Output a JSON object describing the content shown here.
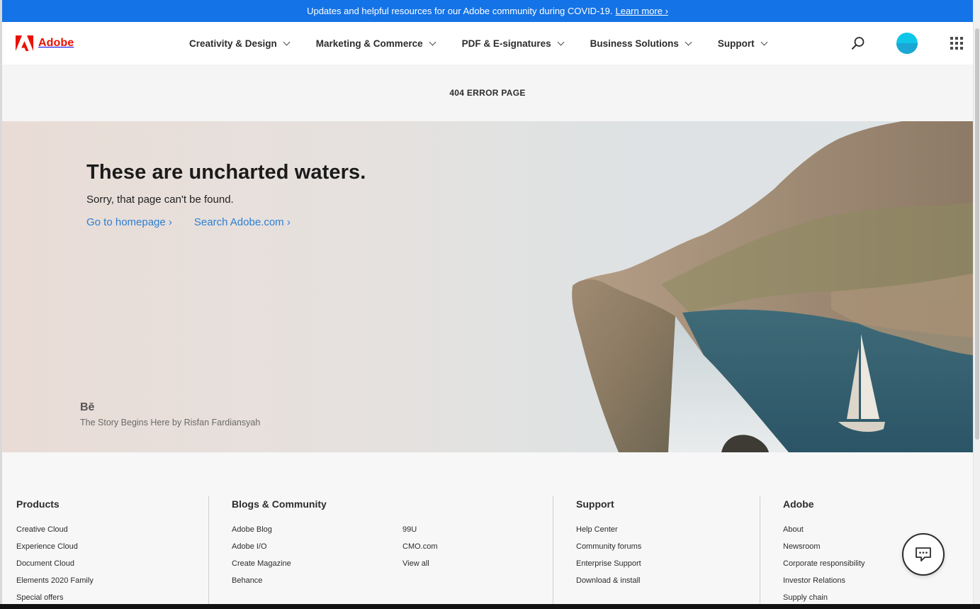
{
  "banner": {
    "text": "Updates and helpful resources for our Adobe community during COVID-19.",
    "link": "Learn more ›"
  },
  "header": {
    "logo_text": "Adobe",
    "nav": [
      {
        "label": "Creativity & Design"
      },
      {
        "label": "Marketing & Commerce"
      },
      {
        "label": "PDF & E-signatures"
      },
      {
        "label": "Business Solutions"
      },
      {
        "label": "Support"
      }
    ],
    "icons": [
      "search-icon",
      "avatar",
      "apps-grid-icon"
    ]
  },
  "page_title": "404 ERROR PAGE",
  "hero": {
    "heading": "These are uncharted waters.",
    "subheading": "Sorry, that page can't be found.",
    "links": [
      "Go to homepage ›",
      "Search Adobe.com ›"
    ],
    "behance_mark": "Bē",
    "credit": "The Story Begins Here by Risfan Fardiansyah"
  },
  "footer": {
    "columns": [
      {
        "title": "Products",
        "items": [
          "Creative Cloud",
          "Experience Cloud",
          "Document Cloud",
          "Elements 2020 Family",
          "Special offers"
        ]
      },
      {
        "title": "Blogs & Community",
        "items": [
          "Adobe Blog",
          "Adobe I/O",
          "Create Magazine",
          "Behance"
        ],
        "items2": [
          "99U",
          "CMO.com",
          "View all"
        ]
      },
      {
        "title": "Support",
        "items": [
          "Help Center",
          "Community forums",
          "Enterprise Support",
          "Download & install"
        ]
      },
      {
        "title": "Adobe",
        "items": [
          "About",
          "Newsroom",
          "Corporate responsibility",
          "Investor Relations",
          "Supply chain"
        ]
      }
    ]
  },
  "colors": {
    "banner_blue": "#1473e6",
    "adobe_red": "#eb1000",
    "link_blue": "#2d7fd2"
  }
}
